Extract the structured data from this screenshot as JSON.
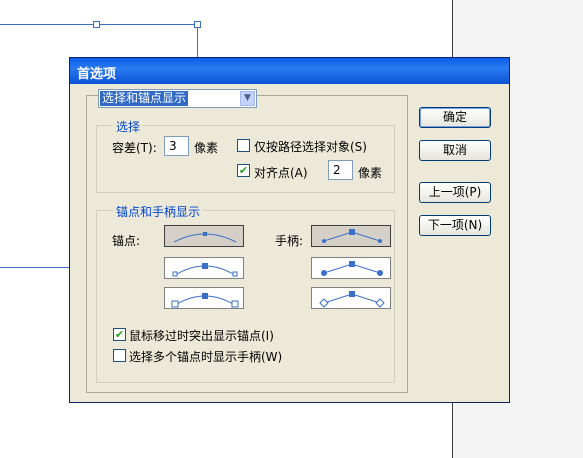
{
  "dialog": {
    "title": "首选项",
    "category_selected": "选择和锚点显示",
    "selection": {
      "legend": "选择",
      "tolerance_label": "容差(T):",
      "tolerance_value": "3",
      "tolerance_unit": "像素",
      "object_by_path_label": "仅按路径选择对象(S)",
      "object_by_path_checked": false,
      "snap_label": "对齐点(A)",
      "snap_checked": true,
      "snap_value": "2",
      "snap_unit": "像素"
    },
    "anchor_display": {
      "legend": "锚点和手柄显示",
      "anchors_label": "锚点:",
      "handles_label": "手柄:",
      "highlight_label": "鼠标移过时突出显示锚点(I)",
      "highlight_checked": true,
      "show_handles_label": "选择多个锚点时显示手柄(W)",
      "show_handles_checked": false
    },
    "buttons": {
      "ok": "确定",
      "cancel": "取消",
      "prev": "上一项(P)",
      "next": "下一项(N)"
    }
  },
  "colors": {
    "title_bar": "#0a5ee8",
    "accent": "#316ac5",
    "guide": "#3b6fc6"
  }
}
